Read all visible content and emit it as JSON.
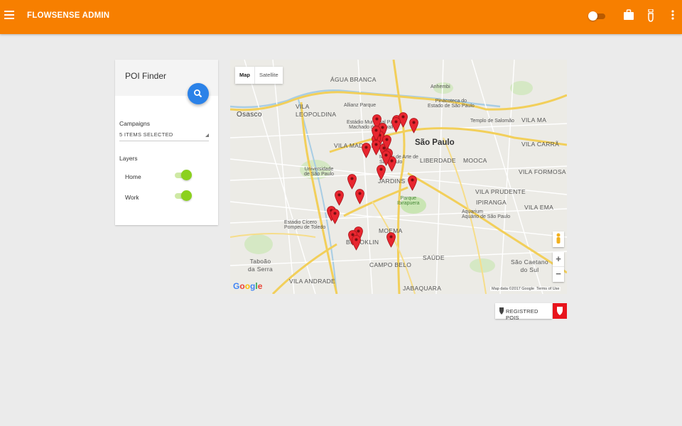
{
  "header": {
    "title": "FLOWSENSE ADMIN",
    "icons": [
      "menu-icon",
      "toggle-switch",
      "briefcase-icon",
      "hand-icon",
      "more-vert-icon"
    ],
    "brand_color": "#f77f00"
  },
  "poi_finder": {
    "title": "POI Finder",
    "search_icon": "search-icon",
    "campaigns_label": "Campaigns",
    "campaigns_value": "5 ITEMS SELECTED",
    "layers_label": "Layers",
    "layers": [
      {
        "label": "Home",
        "on": true
      },
      {
        "label": "Work",
        "on": true
      }
    ]
  },
  "map": {
    "type_buttons": [
      "Map",
      "Satellite"
    ],
    "selected_type": "Map",
    "labels": {
      "agua_branca": "ÁGUA BRANCA",
      "anhembi": "Anhembi",
      "osasco": "Osasco",
      "vila_leopoldina": "VILA\nLEOPOLDINA",
      "allianz": "Allianz Parque",
      "pinacoteca": "Pinacoteca do\nEstado de São Paulo",
      "templo": "Templo de Salomão",
      "vila_maria": "VILA MA",
      "estadio_pacaembu": "Estádio Municipal Paulo\nMachado de Carvalho",
      "vila_carrao": "VILA CARRÃ",
      "vila_madalena": "VILA MADALENA",
      "sao_paulo": "São Paulo",
      "masp": "Museu de Arte de\nSão Paulo",
      "liberdade": "LIBERDADE",
      "mooca": "MOOCA",
      "usp": "Universidade\nde São Paulo",
      "jardins": "JARDINS",
      "vila_formosa": "VILA FORMOSA",
      "vila_prudente": "VILA PRUDENTE",
      "ibirapuera": "Parque\nIbirapuera",
      "vila_ema": "VILA EMA",
      "ipiranga": "IPIRANGA",
      "morumbi": "Estádio Cícero\nPompeu de Toledo",
      "aquarium": "Aquarium\nAquário de São Paulo",
      "moema": "MOEMA",
      "brooklin": "BROOKLIN",
      "saude": "SAÚDE",
      "taboao": "Taboão\nda Serra",
      "campo_belo": "CAMPO BELO",
      "sao_caetano": "São Caetano\ndo Sul",
      "vila_andrade": "VILA ANDRADE",
      "jabaquara": "JABAQUARA"
    },
    "attribution": "Map data ©2017 Google",
    "terms": "Terms of Use",
    "logo": "Google",
    "zoom_in": "+",
    "zoom_out": "−",
    "pin_color": "#e8262f",
    "pin_count": 27
  },
  "registered_pois": {
    "label": "REGISTRED POIS",
    "icon": "pin-icon",
    "button_color": "#e8141c"
  }
}
